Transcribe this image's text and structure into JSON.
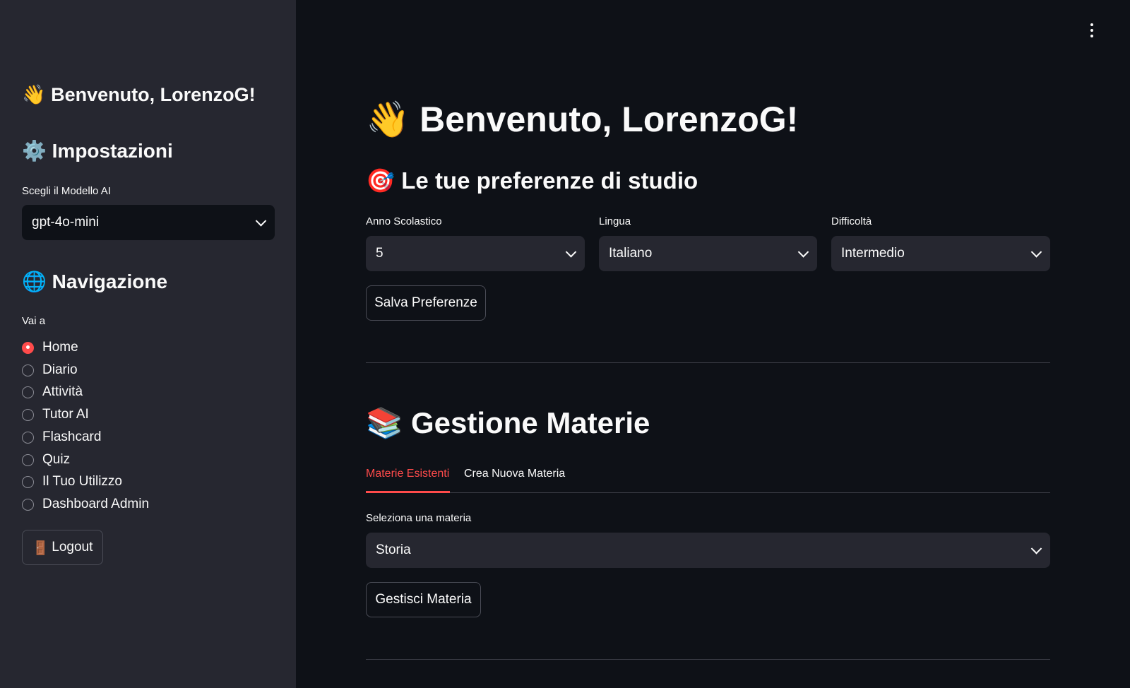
{
  "sidebar": {
    "welcome": "Benvenuto, LorenzoG!",
    "welcome_emoji": "👋",
    "settings_title": "Impostazioni",
    "settings_emoji": "⚙️",
    "model_label": "Scegli il Modello AI",
    "model_value": "gpt-4o-mini",
    "nav_title": "Navigazione",
    "nav_emoji": "🌐",
    "nav_label": "Vai a",
    "nav_items": [
      {
        "label": "Home",
        "selected": true
      },
      {
        "label": "Diario",
        "selected": false
      },
      {
        "label": "Attività",
        "selected": false
      },
      {
        "label": "Tutor AI",
        "selected": false
      },
      {
        "label": "Flashcard",
        "selected": false
      },
      {
        "label": "Quiz",
        "selected": false
      },
      {
        "label": "Il Tuo Utilizzo",
        "selected": false
      },
      {
        "label": "Dashboard Admin",
        "selected": false
      }
    ],
    "logout_emoji": "🚪",
    "logout_label": "Logout"
  },
  "main": {
    "title": "Benvenuto, LorenzoG!",
    "title_emoji": "👋",
    "prefs_title": "Le tue preferenze di studio",
    "prefs_emoji": "🎯",
    "year_label": "Anno Scolastico",
    "year_value": "5",
    "language_label": "Lingua",
    "language_value": "Italiano",
    "difficulty_label": "Difficoltà",
    "difficulty_value": "Intermedio",
    "save_button": "Salva Preferenze",
    "subjects_title": "Gestione Materie",
    "subjects_emoji": "📚",
    "tabs": [
      {
        "label": "Materie Esistenti",
        "active": true
      },
      {
        "label": "Crea Nuova Materia",
        "active": false
      }
    ],
    "subject_label": "Seleziona una materia",
    "subject_value": "Storia",
    "manage_button": "Gestisci Materia"
  },
  "colors": {
    "accent": "#ff4b4b",
    "background": "#0e1117",
    "sidebar": "#262730"
  },
  "icons": {
    "menu": "kebab-menu-icon",
    "dropdown": "chevron-down-icon"
  }
}
